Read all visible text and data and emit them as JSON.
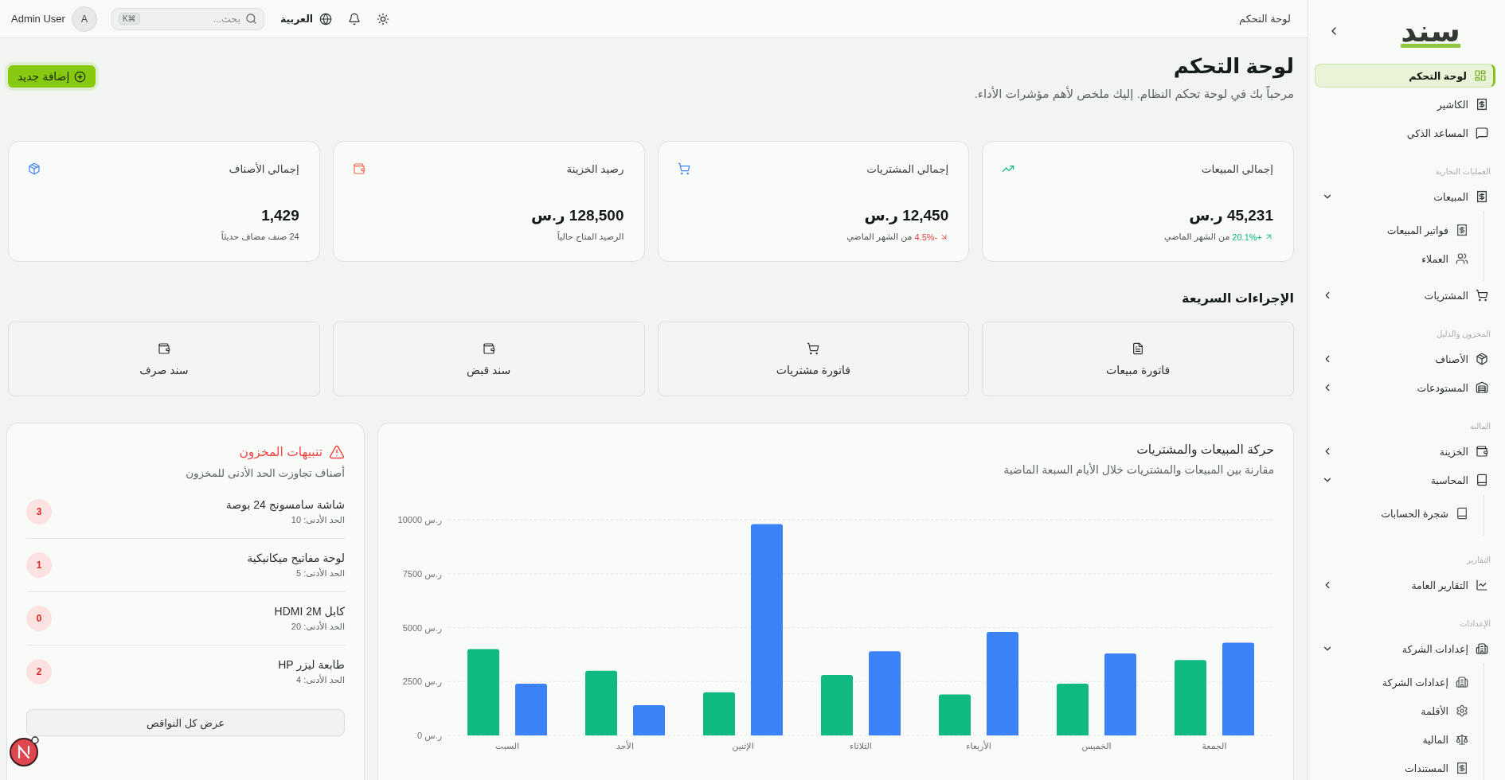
{
  "sidebar": {
    "logo": "سند",
    "items": [
      {
        "kind": "item",
        "label": "لوحة التحكم",
        "selected": true
      },
      {
        "kind": "item",
        "label": "الكاشير",
        "selected": false
      },
      {
        "kind": "item",
        "label": "المساعد الذكي",
        "selected": false
      },
      {
        "kind": "section",
        "label": "العمليات التجارية"
      },
      {
        "kind": "group",
        "label": "المبيعات",
        "selected": false,
        "expanded": true,
        "children": [
          {
            "label": "فواتير المبيعات",
            "selected": false
          },
          {
            "label": "العملاء",
            "selected": false
          }
        ]
      },
      {
        "kind": "group",
        "label": "المشتريات",
        "selected": false,
        "expanded": false
      },
      {
        "kind": "section",
        "label": "المخزون والدليل"
      },
      {
        "kind": "group",
        "label": "الأصناف",
        "selected": false,
        "expanded": false
      },
      {
        "kind": "group",
        "label": "المستودعات",
        "selected": false,
        "expanded": false
      },
      {
        "kind": "section",
        "label": "المالية"
      },
      {
        "kind": "group",
        "label": "الخزينة",
        "selected": false,
        "expanded": false
      },
      {
        "kind": "group",
        "label": "المحاسبة",
        "selected": false,
        "expanded": true,
        "children": [
          {
            "label": "شجرة الحسابات",
            "selected": false
          }
        ]
      },
      {
        "kind": "section",
        "label": "التقارير"
      },
      {
        "kind": "group",
        "label": "التقارير العامة",
        "selected": false,
        "expanded": false
      },
      {
        "kind": "section",
        "label": "الإعدادات"
      },
      {
        "kind": "group",
        "label": "إعدادات الشركة",
        "selected": false,
        "expanded": true,
        "children": [
          {
            "label": "إعدادات الشركة",
            "selected": false
          },
          {
            "label": "الأقلمة",
            "selected": false
          },
          {
            "label": "المالية",
            "selected": false
          },
          {
            "label": "المستندات",
            "selected": false
          }
        ]
      }
    ]
  },
  "header": {
    "breadcrumb": "لوحة التحكم",
    "language": "العربية",
    "search": {
      "placeholder": "بحث...",
      "shortcut": "⌘K"
    },
    "user": {
      "initial": "A",
      "name": "Admin User"
    }
  },
  "page": {
    "title": "لوحة التحكم",
    "subtitle": "مرحباً بك في لوحة تحكم النظام. إليك ملخص لأهم مؤشرات الأداء.",
    "add_button": "إضافة جديد"
  },
  "stats": [
    {
      "title": "إجمالي المبيعات",
      "value": "45,231 ر.س",
      "trend": {
        "kind": "up",
        "change": "+20.1%"
      },
      "note": "من الشهر الماضي"
    },
    {
      "title": "إجمالي المشتريات",
      "value": "12,450 ر.س",
      "trend": {
        "kind": "down",
        "change": "-4.5%"
      },
      "note": "من الشهر الماضي"
    },
    {
      "title": "رصيد الخزينة",
      "value": "128,500 ر.س",
      "note": "الرصيد المتاح حالياً"
    },
    {
      "title": "إجمالي الأصناف",
      "value": "1,429",
      "note": "24 صنف مضاف حديثاً"
    }
  ],
  "quick_actions": {
    "title": "الإجراءات السريعة",
    "items": [
      {
        "label": "فاتورة مبيعات"
      },
      {
        "label": "فاتورة مشتريات"
      },
      {
        "label": "سند قبض"
      },
      {
        "label": "سند صرف"
      }
    ]
  },
  "sales_chart": {
    "title": "حركة المبيعات والمشتريات",
    "subtitle": "مقارنة بين المبيعات والمشتريات خلال الأيام السبعة الماضية",
    "chart_data": {
      "type": "bar",
      "grid": true,
      "categories": [
        "السبت",
        "الأحد",
        "الإثنين",
        "الثلاثاء",
        "الأربعاء",
        "الخميس",
        "الجمعة"
      ],
      "series": [
        {
          "color": "#10b981",
          "values": [
            4000,
            3000,
            2000,
            2800,
            1900,
            2400,
            3500
          ]
        },
        {
          "color": "#3b82f6",
          "values": [
            2400,
            1400,
            9800,
            3900,
            4800,
            3800,
            4300
          ]
        }
      ],
      "ylim": [
        0,
        10000
      ],
      "yticks": [
        {
          "value": 0,
          "label": "0 ر.س"
        },
        {
          "value": 2500,
          "label": "2500 ر.س"
        },
        {
          "value": 5000,
          "label": "5000 ر.س"
        },
        {
          "value": 7500,
          "label": "7500 ر.س"
        },
        {
          "value": 10000,
          "label": "10000 ر.س"
        }
      ]
    }
  },
  "stock_alerts": {
    "title": "تنبيهات المخزون",
    "subtitle": "أصناف تجاوزت الحد الأدنى للمخزون",
    "items": [
      {
        "name": "شاشة سامسونج 24 بوصة",
        "minimum": "الحد الأدنى: 10",
        "quantity": "3"
      },
      {
        "name": "لوحة مفاتيح ميكانيكية",
        "minimum": "الحد الأدنى: 5",
        "quantity": "1"
      },
      {
        "name": "كابل HDMI 2M",
        "minimum": "الحد الأدنى: 20",
        "quantity": "0"
      },
      {
        "name": "طابعة ليزر HP",
        "minimum": "الحد الأدنى: 4",
        "quantity": "2"
      }
    ],
    "button": "عرض كل النواقص"
  }
}
